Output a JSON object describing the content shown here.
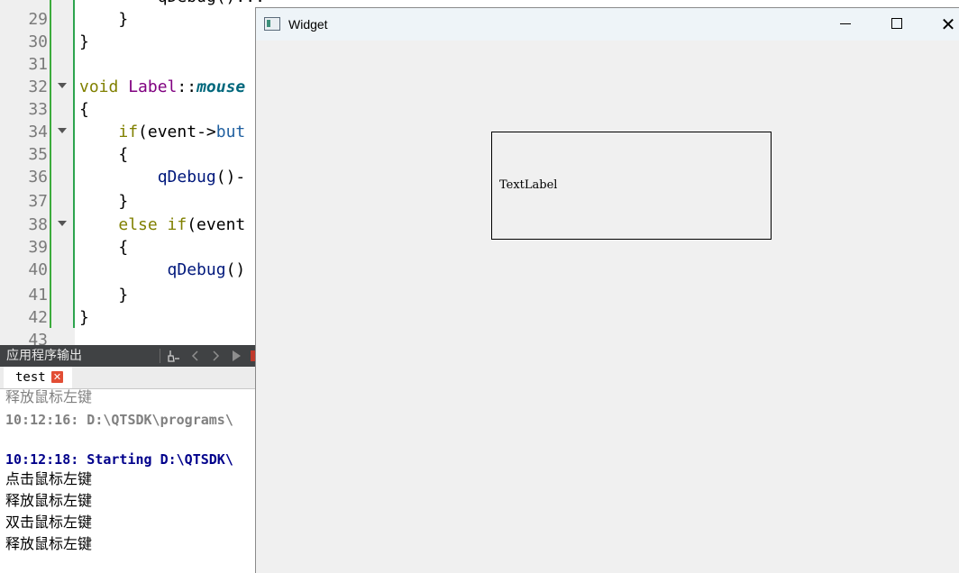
{
  "editor": {
    "lines": [
      {
        "num": "29",
        "text": "    }"
      },
      {
        "num": "30",
        "text": "}"
      },
      {
        "num": "31",
        "text": ""
      },
      {
        "num": "32",
        "kw": "void ",
        "cls": "Label",
        "sep": "::",
        "fn": "mouse"
      },
      {
        "num": "33",
        "text": "{"
      },
      {
        "num": "34",
        "indent": "    ",
        "kw": "if",
        "rest": "(event->",
        "mem": "but"
      },
      {
        "num": "35",
        "text": "    {"
      },
      {
        "num": "36",
        "indent": "        ",
        "call": "qDebug",
        "rest": "()-"
      },
      {
        "num": "37",
        "text": "    }"
      },
      {
        "num": "38",
        "indent": "    ",
        "kw": "else if",
        "rest": "(event"
      },
      {
        "num": "39",
        "text": "    {"
      },
      {
        "num": "40",
        "indent": "        ",
        "call": " qDebug",
        "rest": "()"
      },
      {
        "num": "41",
        "text": "    }"
      },
      {
        "num": "42",
        "text": "}"
      },
      {
        "num": "43",
        "text": ""
      }
    ]
  },
  "output": {
    "title": "应用程序输出",
    "tab_label": "test",
    "tab_close": "✕",
    "log": [
      {
        "text": "释放鼠标左键",
        "style": "gray"
      },
      {
        "text": "10:12:16: D:\\QTSDK\\programs\\",
        "style": "gray-bold"
      },
      {
        "text": "",
        "style": "black"
      },
      {
        "text": "10:12:18: Starting D:\\QTSDK\\",
        "style": "blue-bold"
      },
      {
        "text": "点击鼠标左键",
        "style": "black"
      },
      {
        "text": "释放鼠标左键",
        "style": "black"
      },
      {
        "text": "双击鼠标左键",
        "style": "black"
      },
      {
        "text": "释放鼠标左键",
        "style": "black"
      }
    ]
  },
  "widget": {
    "title": "Widget",
    "label_text": "TextLabel",
    "close_glyph": "✕"
  }
}
